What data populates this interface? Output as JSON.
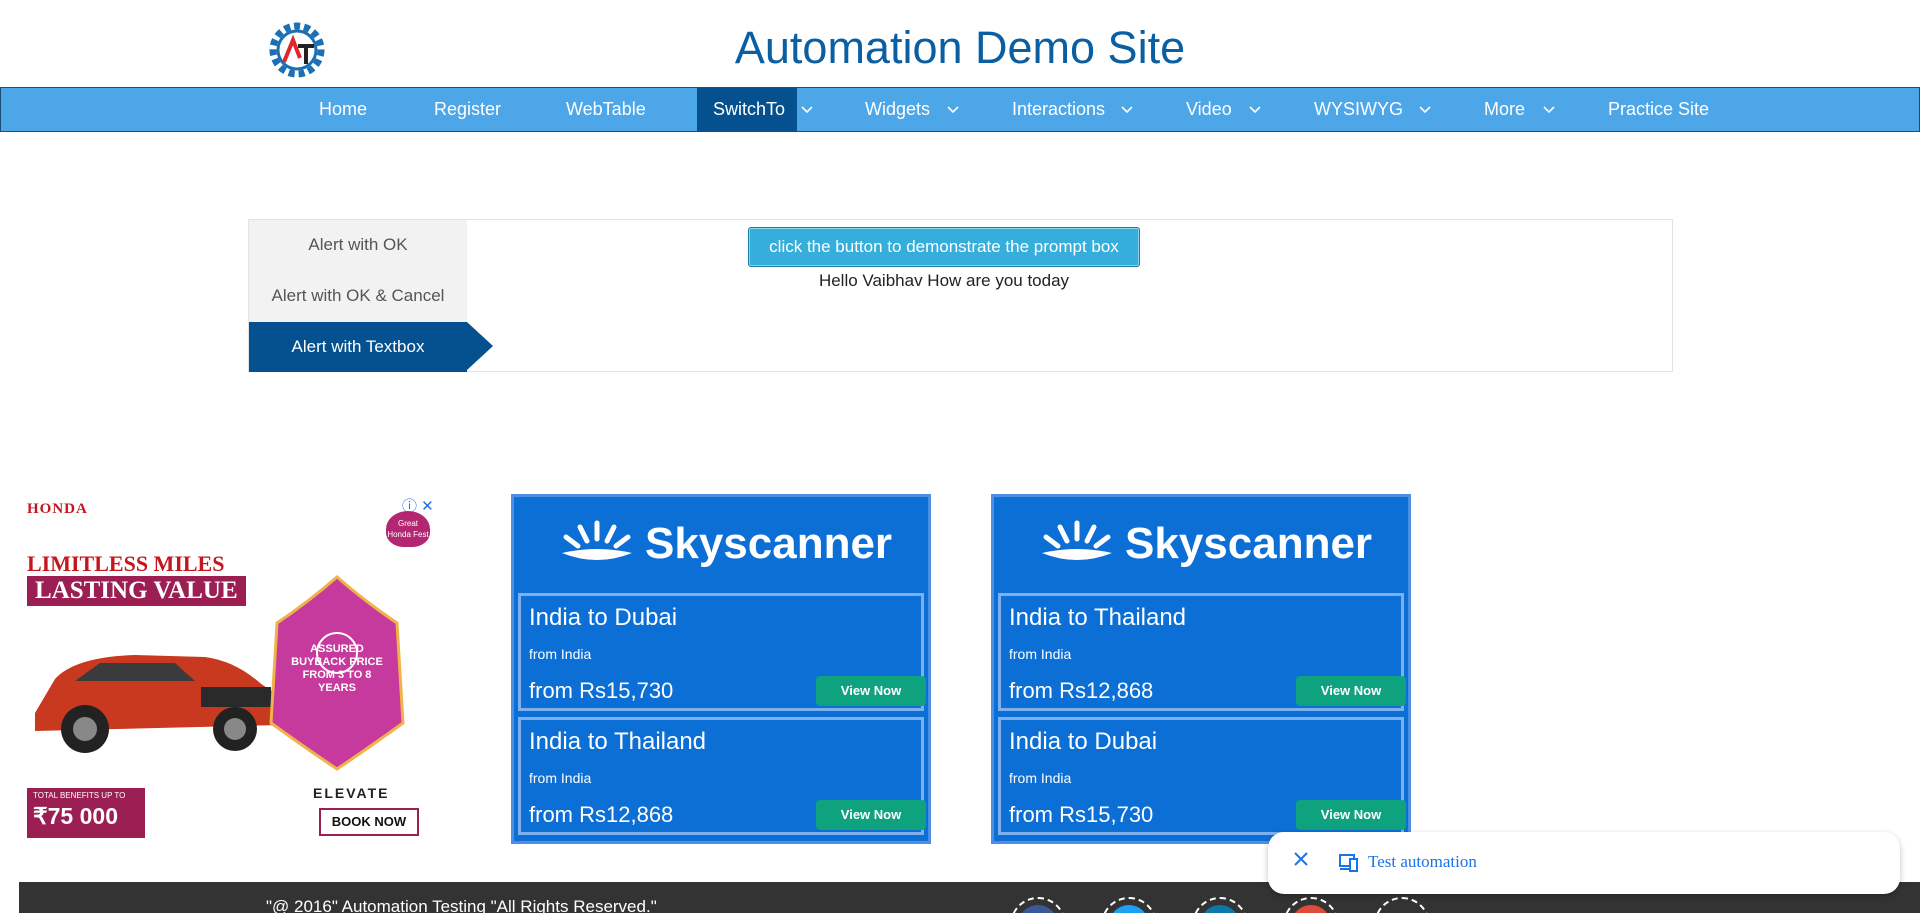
{
  "header": {
    "title": "Automation Demo Site",
    "logo": "gear-logo-icon"
  },
  "nav": {
    "items": [
      {
        "label": "Home"
      },
      {
        "label": "Register"
      },
      {
        "label": "WebTable"
      },
      {
        "label": "SwitchTo"
      },
      {
        "label": "Widgets"
      },
      {
        "label": "Interactions"
      },
      {
        "label": "Video"
      },
      {
        "label": "WYSIWYG"
      },
      {
        "label": "More"
      },
      {
        "label": "Practice Site"
      }
    ],
    "active": "SwitchTo"
  },
  "tabs": [
    {
      "label": "Alert with OK"
    },
    {
      "label": "Alert with OK & Cancel"
    },
    {
      "label": "Alert with Textbox"
    }
  ],
  "prompt": {
    "button_label": "click the button to demonstrate the prompt box",
    "result": "Hello Vaibhav How are you today"
  },
  "ads": {
    "honda": {
      "brand": "HONDA",
      "headline1": "LIMITLESS MILES",
      "headline2": "LASTING VALUE",
      "lantern_text": "ASSURED BUYBACK PRICE FROM 3 TO 8 YEARS",
      "total_small": "TOTAL BENEFITS UP TO",
      "total_big": "₹75 000",
      "model": "ELEVATE",
      "cta": "BOOK NOW",
      "badge": "Great Honda Fest"
    },
    "sky1": {
      "logo": "Skyscanner",
      "cards": [
        {
          "title": "India to Dubai",
          "sub": "from India",
          "price": "from Rs15,730",
          "cta": "View Now"
        },
        {
          "title": "India to Thailand",
          "sub": "from India",
          "price": "from Rs12,868",
          "cta": "View Now"
        }
      ]
    },
    "sky2": {
      "logo": "Skyscanner",
      "cards": [
        {
          "title": "India to Thailand",
          "sub": "from India",
          "price": "from Rs12,868",
          "cta": "View Now"
        },
        {
          "title": "India to Dubai",
          "sub": "from India",
          "price": "from Rs15,730",
          "cta": "View Now"
        }
      ]
    }
  },
  "footer": {
    "copyright": "\"@ 2016\" Automation Testing \"All Rights Reserved.\""
  },
  "floatbar": {
    "label": "Test automation"
  },
  "colors": {
    "nav": "#4ca6e8",
    "nav_active": "#05508f",
    "title": "#0a5fa3",
    "button": "#35aedb",
    "footer": "#333333"
  }
}
